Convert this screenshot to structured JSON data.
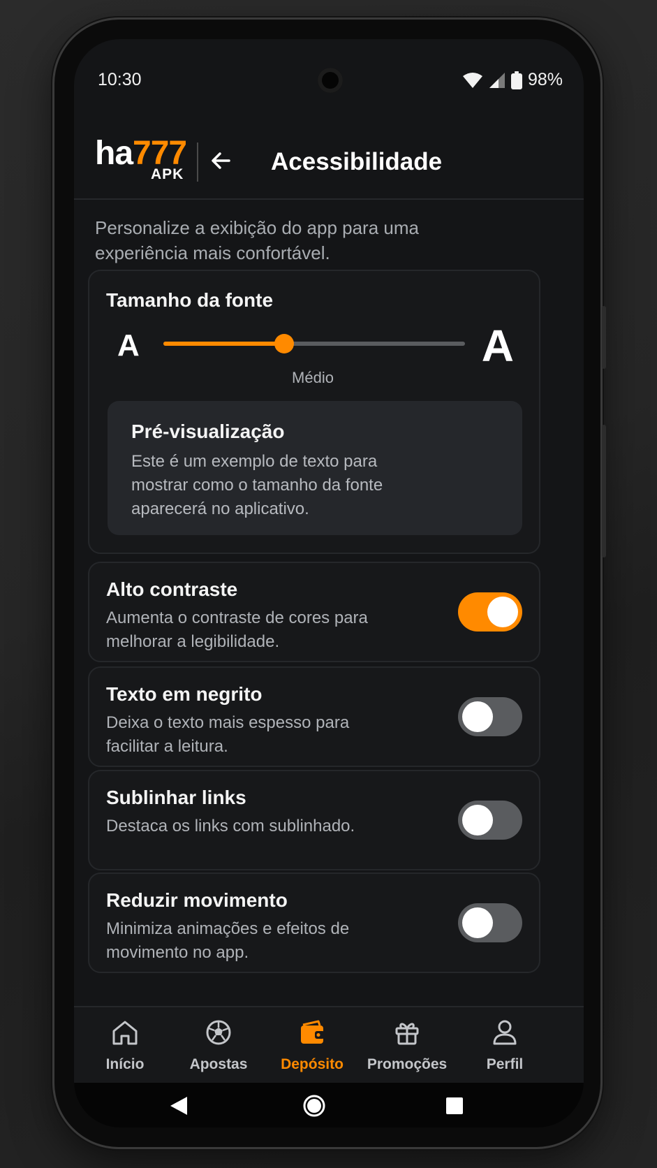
{
  "status_bar": {
    "time": "10:30",
    "battery": "98%",
    "icons": [
      "wifi-icon",
      "signal-icon",
      "battery-icon"
    ]
  },
  "header": {
    "logo_main_a": "ha",
    "logo_main_b": "777",
    "logo_sub": "APK",
    "back_icon": "arrow-left-icon",
    "title": "Acessibilidade"
  },
  "intro": "Personalize a exibição do app para uma experiência mais confortável.",
  "font_size": {
    "title": "Tamanho da fonte",
    "small_label": "A",
    "large_label": "A",
    "level": 0.4,
    "value_label": "Médio",
    "preview_title": "Pré-visualização",
    "preview_text": "Este é um exemplo de texto para mostrar como o tamanho da fonte aparecerá no aplicativo."
  },
  "settings": [
    {
      "title": "Alto contraste",
      "desc": "Aumenta o contraste de cores para melhorar a legibilidade.",
      "on": true
    },
    {
      "title": "Texto em negrito",
      "desc": "Deixa o texto mais espesso para facilitar a leitura.",
      "on": false
    },
    {
      "title": "Sublinhar links",
      "desc": "Destaca os links com sublinhado.",
      "on": false
    },
    {
      "title": "Reduzir movimento",
      "desc": "Minimiza animações e efeitos de movimento no app.",
      "on": false
    }
  ],
  "nav": [
    {
      "label": "Início",
      "icon": "home-icon",
      "active": false
    },
    {
      "label": "Apostas",
      "icon": "soccer-ball-icon",
      "active": false
    },
    {
      "label": "Depósito",
      "icon": "wallet-icon",
      "active": true
    },
    {
      "label": "Promoções",
      "icon": "gift-icon",
      "active": false
    },
    {
      "label": "Perfil",
      "icon": "user-icon",
      "active": false
    }
  ],
  "system_nav": [
    "back-triangle-icon",
    "home-circle-icon",
    "recents-square-icon"
  ],
  "colors": {
    "accent": "#ff8a00",
    "background": "#141517",
    "card": "#17181a",
    "toggle_off": "#5a5c5f"
  }
}
